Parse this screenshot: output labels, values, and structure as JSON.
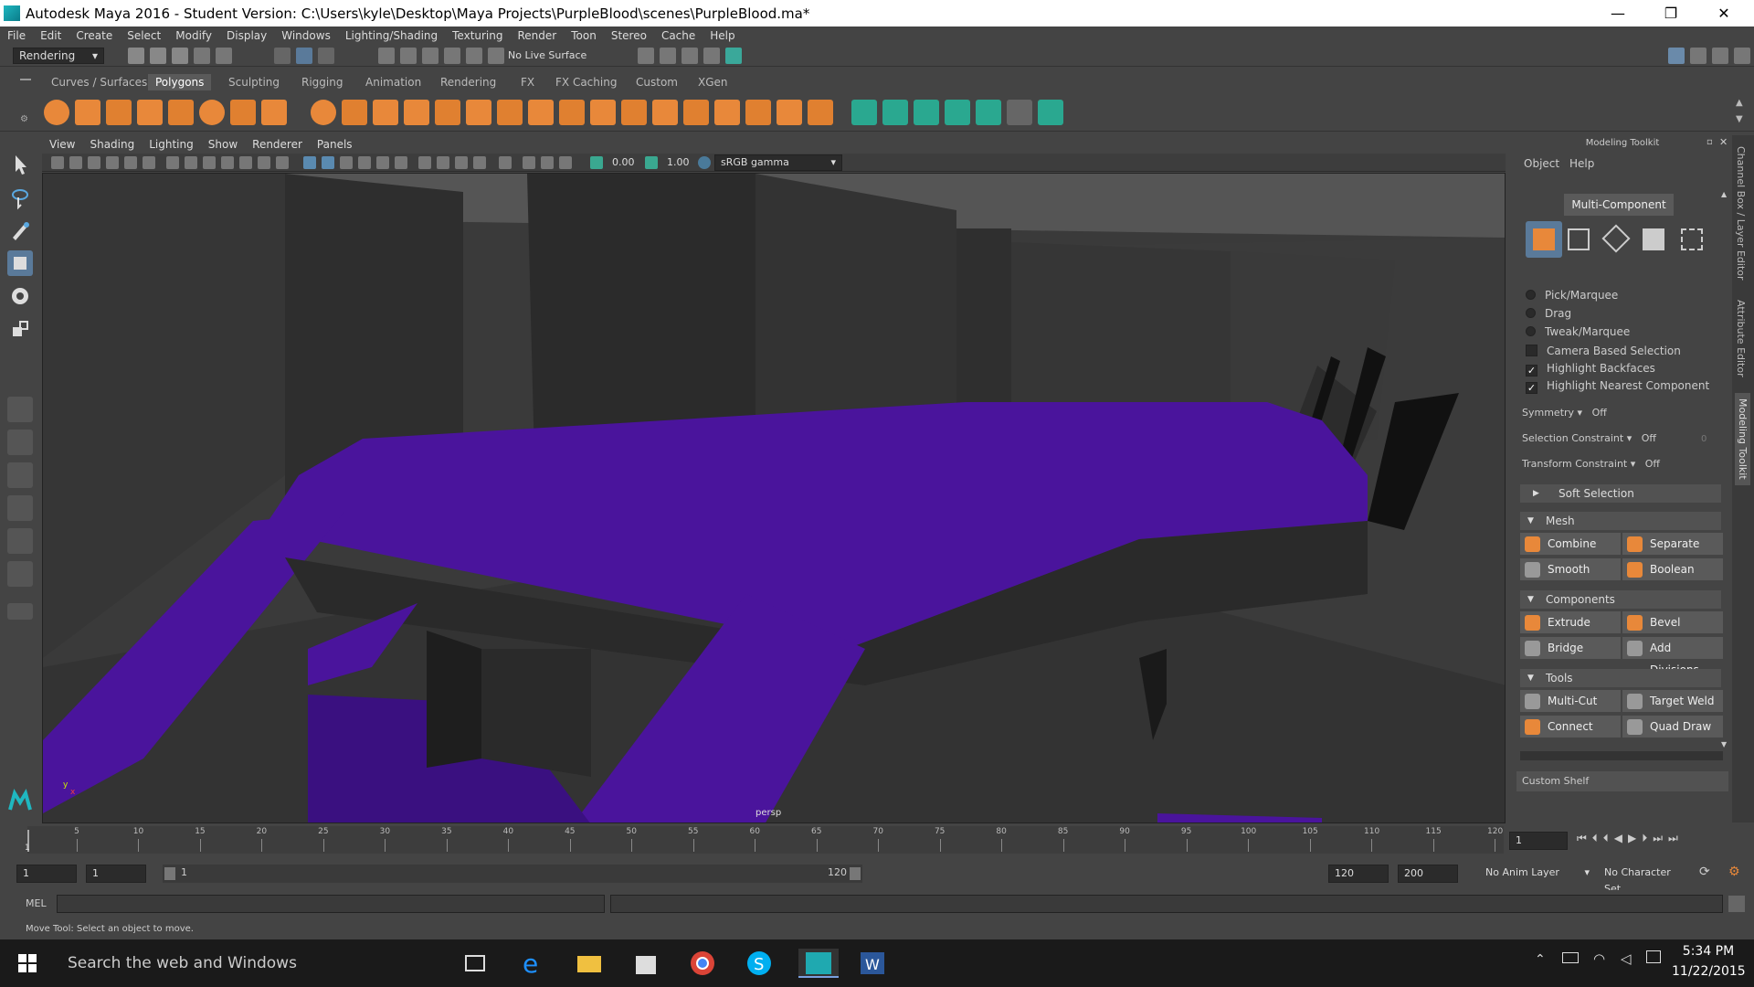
{
  "window": {
    "title": "Autodesk Maya 2016 - Student Version: C:\\Users\\kyle\\Desktop\\Maya Projects\\PurpleBlood\\scenes\\PurpleBlood.ma*",
    "minimize": "—",
    "maximize": "❐",
    "close": "✕"
  },
  "menus": [
    "File",
    "Edit",
    "Create",
    "Select",
    "Modify",
    "Display",
    "Windows",
    "Lighting/Shading",
    "Texturing",
    "Render",
    "Toon",
    "Stereo",
    "Cache",
    "Help"
  ],
  "status": {
    "menuset": "Rendering",
    "live": "No Live Surface"
  },
  "shelf_tabs": [
    "Curves / Surfaces",
    "Polygons",
    "Sculpting",
    "Rigging",
    "Animation",
    "Rendering",
    "FX",
    "FX Caching",
    "Custom",
    "XGen"
  ],
  "viewport": {
    "menus": [
      "View",
      "Shading",
      "Lighting",
      "Show",
      "Renderer",
      "Panels"
    ],
    "exposure": "0.00",
    "gamma": "1.00",
    "colorspace": "sRGB gamma",
    "camera": "persp",
    "axis_y": "y",
    "axis_x": "x"
  },
  "toolkit": {
    "title": "Modeling Toolkit",
    "menu_object": "Object",
    "menu_help": "Help",
    "mode": "Multi-Component",
    "pick": "Pick/Marquee",
    "drag": "Drag",
    "tweak": "Tweak/Marquee",
    "camera_sel": "Camera Based Selection",
    "backfaces": "Highlight Backfaces",
    "nearest": "Highlight Nearest Component",
    "symmetry": "Symmetry",
    "symmetry_val": "Off",
    "selcon": "Selection Constraint",
    "selcon_val": "Off",
    "selcon_num": "0",
    "trcon": "Transform Constraint",
    "trcon_val": "Off",
    "soft": "Soft Selection",
    "mesh": "Mesh",
    "combine": "Combine",
    "separate": "Separate",
    "smooth": "Smooth",
    "boolean": "Boolean",
    "components": "Components",
    "extrude": "Extrude",
    "bevel": "Bevel",
    "bridge": "Bridge",
    "adddiv": "Add Divisions",
    "tools": "Tools",
    "multicut": "Multi-Cut",
    "targetweld": "Target Weld",
    "connect": "Connect",
    "quaddraw": "Quad Draw",
    "custom": "Custom Shelf"
  },
  "side_tabs": [
    "Channel Box / Layer Editor",
    "Attribute Editor",
    "Modeling Toolkit"
  ],
  "timeline": {
    "ticks": [
      "5",
      "10",
      "15",
      "20",
      "25",
      "30",
      "35",
      "40",
      "45",
      "50",
      "55",
      "60",
      "65",
      "70",
      "75",
      "80",
      "85",
      "90",
      "95",
      "100",
      "105",
      "110",
      "115",
      "120"
    ],
    "start_label": "1",
    "current": "1"
  },
  "range": {
    "start": "1",
    "start2": "1",
    "slider_start": "1",
    "slider_end": "120",
    "end": "120",
    "end2": "200",
    "anim_layer": "No Anim Layer",
    "char_set": "No Character Set"
  },
  "cmd": {
    "label": "MEL"
  },
  "help": "Move Tool: Select an object to move.",
  "taskbar": {
    "search": "Search the web and Windows",
    "time": "5:34 PM",
    "date": "11/22/2015"
  }
}
